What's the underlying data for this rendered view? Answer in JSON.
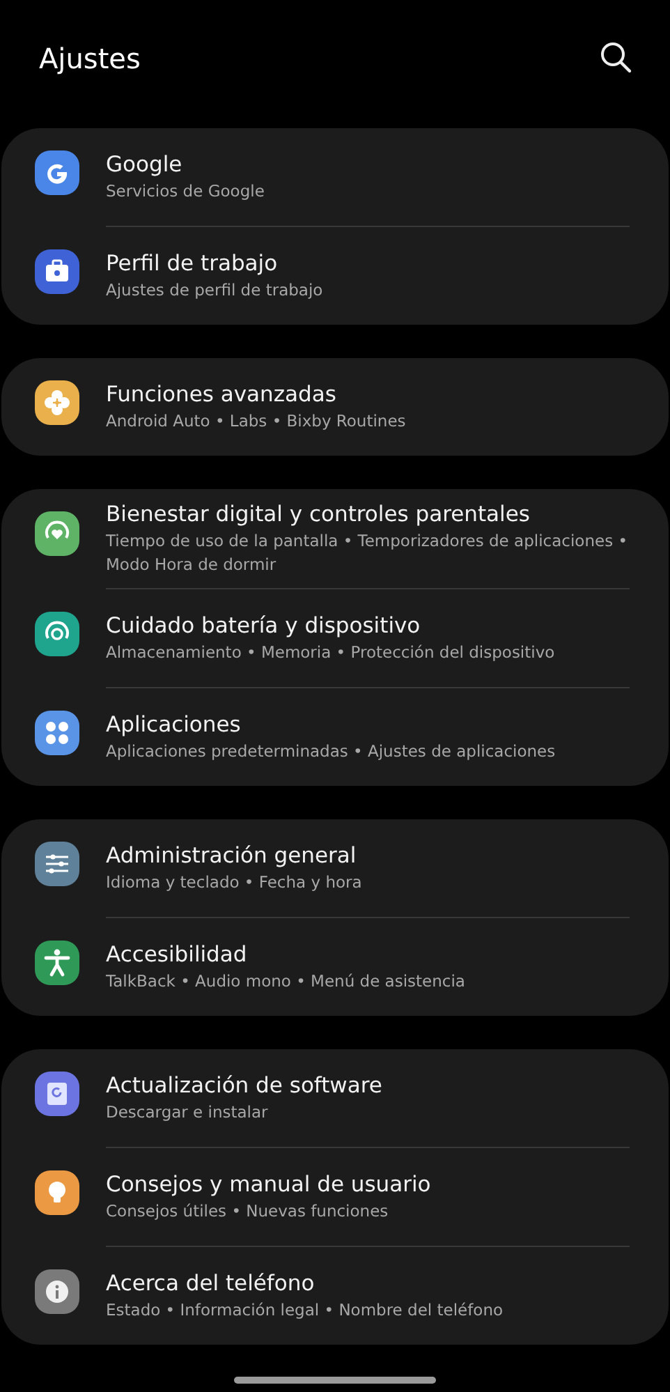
{
  "header": {
    "title": "Ajustes"
  },
  "groups": [
    {
      "items": [
        {
          "title": "Google",
          "subtitle": "Servicios de Google",
          "kind": "google",
          "color": "#4a86e8"
        },
        {
          "title": "Perfil de trabajo",
          "subtitle": "Ajustes de perfil de trabajo",
          "kind": "briefcase",
          "color": "#3f62d6"
        }
      ]
    },
    {
      "items": [
        {
          "title": "Funciones avanzadas",
          "subtitle": "Android Auto • Labs • Bixby Routines",
          "kind": "flower",
          "color": "#e9b04c"
        }
      ]
    },
    {
      "items": [
        {
          "title": "Bienestar digital y controles parentales",
          "subtitle": "Tiempo de uso de la pantalla • Temporizadores de aplicaciones • Modo Hora de dormir",
          "kind": "heart-ring",
          "color": "#5fb366"
        },
        {
          "title": "Cuidado batería y dispositivo",
          "subtitle": "Almacenamiento • Memoria • Protección del dispositivo",
          "kind": "refresh-ring",
          "color": "#1fa58e"
        },
        {
          "title": "Aplicaciones",
          "subtitle": "Aplicaciones predeterminadas • Ajustes de aplicaciones",
          "kind": "dots",
          "color": "#5a94e6"
        }
      ]
    },
    {
      "items": [
        {
          "title": "Administración general",
          "subtitle": "Idioma y teclado • Fecha y hora",
          "kind": "sliders",
          "color": "#5f8199"
        },
        {
          "title": "Accesibilidad",
          "subtitle": "TalkBack • Audio mono • Menú de asistencia",
          "kind": "person",
          "color": "#2f9a58"
        }
      ]
    },
    {
      "items": [
        {
          "title": "Actualización de software",
          "subtitle": "Descargar e instalar",
          "kind": "update",
          "color": "#6b74e0"
        },
        {
          "title": "Consejos y manual de usuario",
          "subtitle": "Consejos útiles • Nuevas funciones",
          "kind": "bulb",
          "color": "#eb9a43"
        },
        {
          "title": "Acerca del teléfono",
          "subtitle": "Estado • Información legal • Nombre del teléfono",
          "kind": "info",
          "color": "#7a7a7a"
        }
      ]
    }
  ]
}
